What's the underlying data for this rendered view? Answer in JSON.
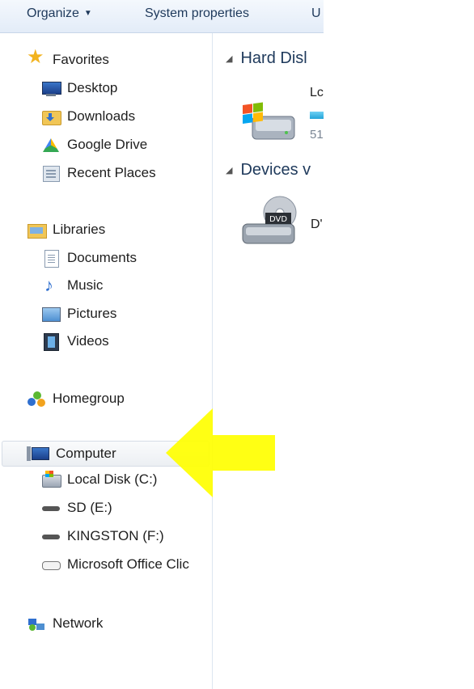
{
  "toolbar": {
    "organize_label": "Organize",
    "system_properties_label": "System properties",
    "overflow_label": "U"
  },
  "nav": {
    "favorites": {
      "label": "Favorites",
      "icon": "star-icon"
    },
    "favorites_items": [
      {
        "label": "Desktop",
        "icon": "desktop-icon"
      },
      {
        "label": "Downloads",
        "icon": "downloads-folder-icon"
      },
      {
        "label": "Google Drive",
        "icon": "google-drive-icon"
      },
      {
        "label": "Recent Places",
        "icon": "recent-places-icon"
      }
    ],
    "libraries": {
      "label": "Libraries",
      "icon": "libraries-icon"
    },
    "libraries_items": [
      {
        "label": "Documents",
        "icon": "document-icon"
      },
      {
        "label": "Music",
        "icon": "music-note-icon"
      },
      {
        "label": "Pictures",
        "icon": "pictures-icon"
      },
      {
        "label": "Videos",
        "icon": "film-icon"
      }
    ],
    "homegroup": {
      "label": "Homegroup",
      "icon": "homegroup-icon"
    },
    "computer": {
      "label": "Computer",
      "icon": "computer-icon",
      "selected": true
    },
    "computer_items": [
      {
        "label": "Local Disk (C:)",
        "icon": "local-disk-icon"
      },
      {
        "label": "SD (E:)",
        "icon": "removable-drive-icon"
      },
      {
        "label": "KINGSTON (F:)",
        "icon": "removable-drive-icon"
      },
      {
        "label": "Microsoft Office Clic",
        "icon": "network-drive-icon"
      }
    ],
    "network": {
      "label": "Network",
      "icon": "network-icon"
    }
  },
  "content": {
    "group_hard_disk": "Hard Disl",
    "group_devices": "Devices v",
    "local_disk_label": "Lc",
    "local_disk_size": "51",
    "dvd_label": "D'",
    "dvd_badge": "DVD"
  },
  "annotation": {
    "arrow_color": "#ffff00"
  },
  "colors": {
    "toolbar_text": "#1e395b",
    "group_header": "#1e395b",
    "usage_bar": "#22a4d8"
  }
}
